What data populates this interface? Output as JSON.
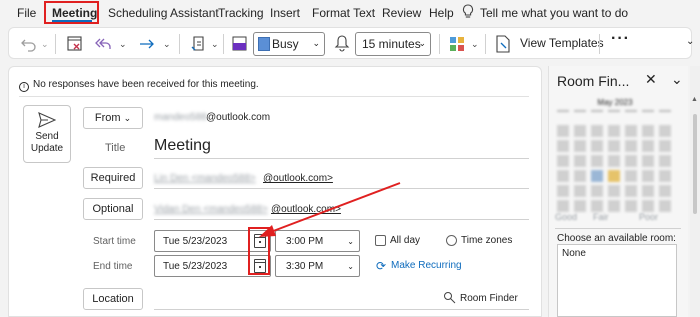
{
  "menu": {
    "items": [
      "File",
      "Meeting",
      "Scheduling Assistant",
      "Tracking",
      "Insert",
      "Format Text",
      "Review",
      "Help"
    ],
    "active": "Meeting",
    "tell_me": "Tell me what you want to do"
  },
  "ribbon": {
    "show_as": "Busy",
    "reminder": "15 minutes",
    "view_templates": "View Templates"
  },
  "info_bar": "No responses have been received for this meeting.",
  "send_update": {
    "line1": "Send",
    "line2": "Update"
  },
  "from": {
    "label": "From",
    "value_blurred": "mandeo588",
    "value_clear": "@outlook.com"
  },
  "title": {
    "label": "Title",
    "value": "Meeting"
  },
  "required": {
    "label": "Required",
    "value_blurred": "Lin Den <mandeo588>",
    "value_clear": "@outlook.com>"
  },
  "optional": {
    "label": "Optional",
    "value_blurred": "Vidan Den <mandeo588>",
    "value_clear": "@outlook.com>"
  },
  "start": {
    "label": "Start time",
    "date": "Tue 5/23/2023",
    "time": "3:00 PM"
  },
  "end": {
    "label": "End time",
    "date": "Tue 5/23/2023",
    "time": "3:30 PM"
  },
  "all_day": "All day",
  "time_zones": "Time zones",
  "make_recurring": "Make Recurring",
  "location_label": "Location",
  "room_finder_link": "Room Finder",
  "pane": {
    "title": "Room Fin...",
    "month": "May 2023",
    "legend": [
      "Good",
      "Fair",
      "Poor"
    ],
    "choose_label": "Choose an available room:",
    "rooms": [
      "None"
    ]
  },
  "colors": {
    "accent": "#0f6cbd",
    "highlight": "#e02020"
  }
}
